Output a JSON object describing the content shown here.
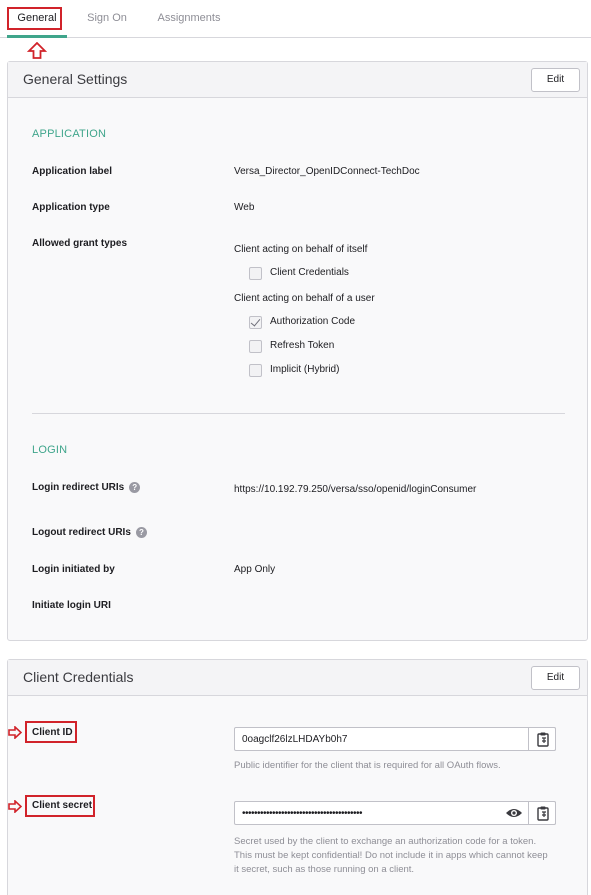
{
  "tabs": [
    {
      "label": "General",
      "active": true
    },
    {
      "label": "Sign On",
      "active": false
    },
    {
      "label": "Assignments",
      "active": false
    }
  ],
  "general_settings": {
    "title": "General Settings",
    "edit_label": "Edit",
    "application_section": "APPLICATION",
    "app_label_label": "Application label",
    "app_label_value": "Versa_Director_OpenIDConnect-TechDoc",
    "app_type_label": "Application type",
    "app_type_value": "Web",
    "grant_types_label": "Allowed grant types",
    "behalf_itself": "Client acting on behalf of itself",
    "behalf_user": "Client acting on behalf of a user",
    "grants": [
      {
        "label": "Client Credentials",
        "checked": false
      },
      {
        "label": "Authorization Code",
        "checked": true
      },
      {
        "label": "Refresh Token",
        "checked": false
      },
      {
        "label": "Implicit (Hybrid)",
        "checked": false
      }
    ],
    "login_section": "LOGIN",
    "login_redirect_label": "Login redirect URIs",
    "login_redirect_value": "https://10.192.79.250/versa/sso/openid/loginConsumer",
    "logout_redirect_label": "Logout redirect URIs",
    "login_initiated_label": "Login initiated by",
    "login_initiated_value": "App Only",
    "initiate_uri_label": "Initiate login URI",
    "help_glyph": "?"
  },
  "client_credentials": {
    "title": "Client Credentials",
    "edit_label": "Edit",
    "client_id_label": "Client ID",
    "client_id_value": "0oagclf26lzLHDAYb0h7",
    "client_id_help": "Public identifier for the client that is required for all OAuth flows.",
    "client_secret_label": "Client secret",
    "client_secret_value": "••••••••••••••••••••••••••••••••••••••••",
    "client_secret_help": "Secret used by the client to exchange an authorization code for a token. This must be kept confidential! Do not include it in apps which cannot keep it secret, such as those running on a client."
  },
  "colors": {
    "accent": "#3fa58b",
    "highlight": "#d1232a"
  },
  "icons": {
    "copy": "clipboard-icon",
    "reveal": "eye-icon",
    "help": "help-icon",
    "annotation_up": "up-arrow-icon",
    "annotation_right": "right-arrow-icon"
  }
}
